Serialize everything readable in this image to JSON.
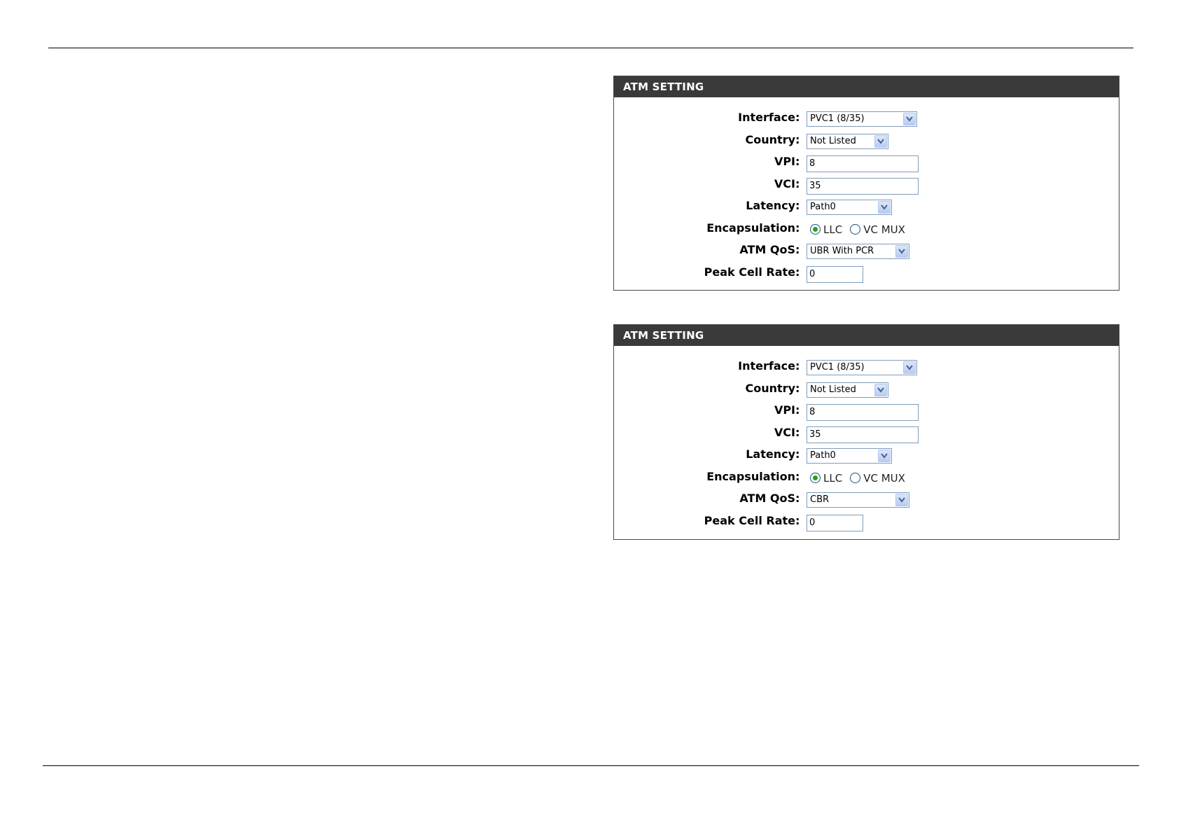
{
  "panels": [
    {
      "title": "ATM SETTING",
      "interface_label": "Interface",
      "interface_value": "PVC1 (8/35)",
      "country_label": "Country",
      "country_value": "Not Listed",
      "vpi_label": "VPI",
      "vpi_value": "8",
      "vci_label": "VCI",
      "vci_value": "35",
      "latency_label": "Latency",
      "latency_value": "Path0",
      "encapsulation_label": "Encapsulation",
      "encap_option_llc": "LLC",
      "encap_option_vcmux": "VC MUX",
      "encap_selected": "LLC",
      "qos_label": "ATM QoS",
      "qos_value": "UBR With PCR",
      "pcr_label": "Peak Cell Rate",
      "pcr_value": "0"
    },
    {
      "title": "ATM SETTING",
      "interface_label": "Interface",
      "interface_value": "PVC1 (8/35)",
      "country_label": "Country",
      "country_value": "Not Listed",
      "vpi_label": "VPI",
      "vpi_value": "8",
      "vci_label": "VCI",
      "vci_value": "35",
      "latency_label": "Latency",
      "latency_value": "Path0",
      "encapsulation_label": "Encapsulation",
      "encap_option_llc": "LLC",
      "encap_option_vcmux": "VC MUX",
      "encap_selected": "LLC",
      "qos_label": "ATM QoS",
      "qos_value": "CBR",
      "pcr_label": "Peak Cell Rate",
      "pcr_value": "0"
    }
  ],
  "colon": ":",
  "icons": {
    "dropdown": "chevron-down-icon"
  }
}
